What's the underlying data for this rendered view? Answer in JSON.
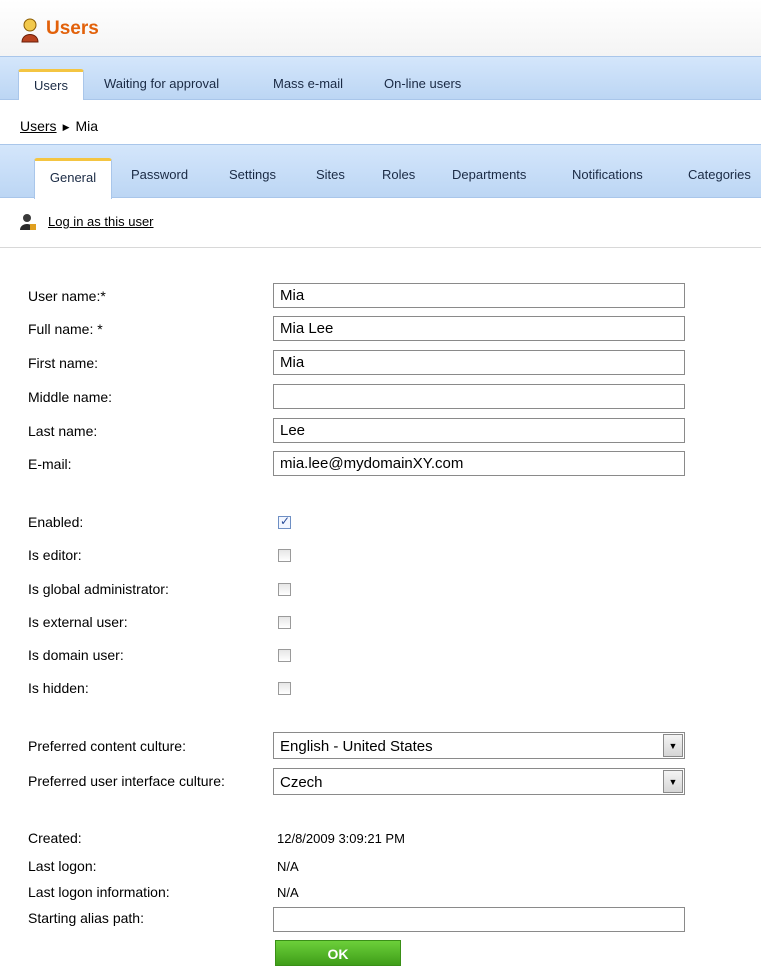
{
  "header": {
    "title": "Users",
    "icon": "user-icon",
    "title_color": "#e2610a"
  },
  "top_tabs": [
    "Users",
    "Waiting for approval",
    "Mass e-mail",
    "On-line users"
  ],
  "breadcrumb": {
    "parent": "Users",
    "current": "Mia"
  },
  "sub_tabs": [
    "General",
    "Password",
    "Settings",
    "Sites",
    "Roles",
    "Departments",
    "Notifications",
    "Categories"
  ],
  "login_as": {
    "label": "Log in as this user",
    "icon": "user-login-icon"
  },
  "fields": {
    "user_name": {
      "label": "User name:*",
      "value": "Mia"
    },
    "full_name": {
      "label": "Full name: *",
      "value": "Mia Lee"
    },
    "first_name": {
      "label": "First name:",
      "value": "Mia"
    },
    "middle_name": {
      "label": "Middle name:",
      "value": ""
    },
    "last_name": {
      "label": "Last name:",
      "value": "Lee"
    },
    "email": {
      "label": "E-mail:",
      "value": "mia.lee@mydomainXY.com"
    }
  },
  "checkboxes": {
    "enabled": {
      "label": "Enabled:",
      "checked": true
    },
    "is_editor": {
      "label": "Is editor:",
      "checked": false
    },
    "is_global_admin": {
      "label": "Is global administrator:",
      "checked": false
    },
    "is_external": {
      "label": "Is external user:",
      "checked": false
    },
    "is_domain": {
      "label": "Is domain user:",
      "checked": false
    },
    "is_hidden": {
      "label": "Is hidden:",
      "checked": false
    }
  },
  "cultures": {
    "content": {
      "label": "Preferred content culture:",
      "value": "English - United States"
    },
    "ui": {
      "label": "Preferred user interface culture:",
      "value": "Czech"
    }
  },
  "info": {
    "created": {
      "label": "Created:",
      "value": "12/8/2009 3:09:21 PM"
    },
    "last_logon": {
      "label": "Last logon:",
      "value": "N/A"
    },
    "last_logon_info": {
      "label": "Last logon information:",
      "value": "N/A"
    }
  },
  "alias_path": {
    "label": "Starting alias path:",
    "value": ""
  },
  "ok_button": {
    "label": "OK",
    "color": "#4fb326"
  }
}
